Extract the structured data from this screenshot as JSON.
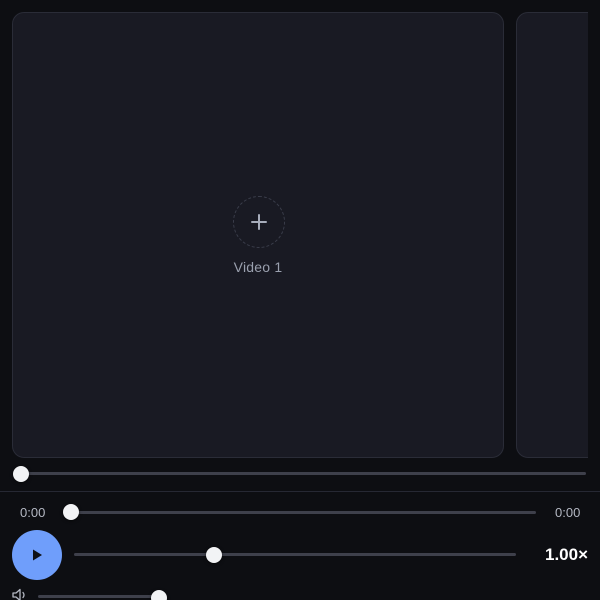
{
  "slots": [
    {
      "label": "Video 1",
      "action_icon": "plus-icon"
    },
    {
      "label": ""
    }
  ],
  "scrubber": {
    "value": 0
  },
  "timeline": {
    "current_time": "0:00",
    "duration": "0:00",
    "progress": 0
  },
  "controls": {
    "play_icon": "play-icon",
    "speed_slider": {
      "value": 0.32
    },
    "speed_label": "1.00×"
  },
  "volume": {
    "icon": "speaker-icon",
    "value": 0.95
  },
  "colors": {
    "background": "#0d0e12",
    "panel": "#191a23",
    "accent": "#6f9efb",
    "track": "#3e404b",
    "knob": "#f2f3f5"
  }
}
